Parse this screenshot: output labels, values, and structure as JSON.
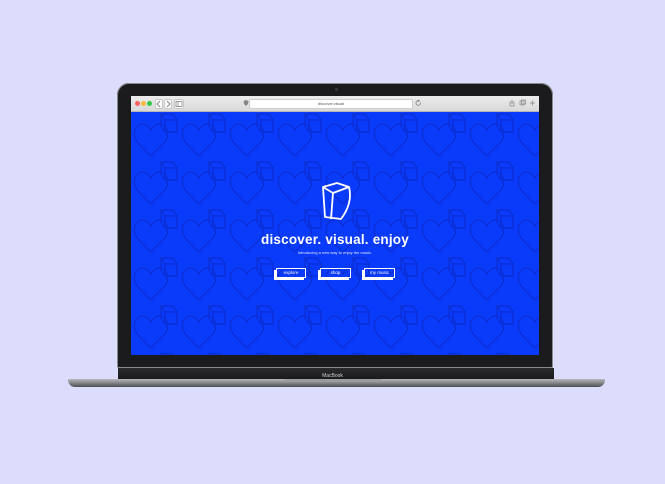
{
  "browser": {
    "address": "discover.visual",
    "back_icon": "chevron-left-icon",
    "forward_icon": "chevron-right-icon",
    "sidebar_icon": "sidebar-icon",
    "shield_icon": "shield-icon",
    "reload_icon": "reload-icon",
    "share_icon": "share-icon",
    "tabs_icon": "tabs-icon",
    "newtab_icon": "plus-icon"
  },
  "hero": {
    "title": "discover. visual. enjoy",
    "subtitle": "introducing a new way to enjoy the music.",
    "buttons": {
      "explore": "explore",
      "shop": "shop",
      "my_music": "my music"
    }
  },
  "device": {
    "brand": "MacBook"
  },
  "colors": {
    "page_background": "#dcdcfd",
    "screen_blue": "#0b3bfa",
    "pattern_stroke": "#0a2ac8",
    "text": "#ffffff"
  }
}
